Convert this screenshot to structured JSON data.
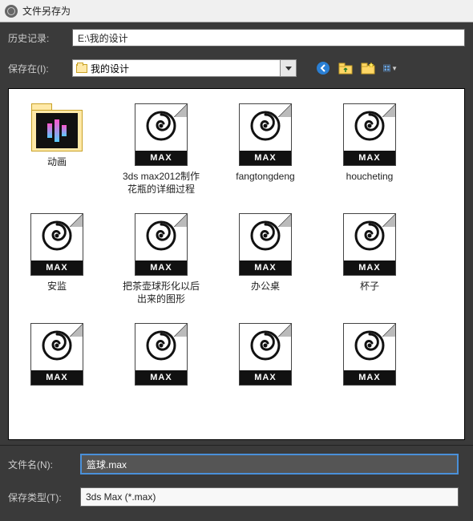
{
  "window": {
    "title": "文件另存为"
  },
  "history": {
    "label": "历史记录:",
    "value": "E:\\我的设计"
  },
  "saveIn": {
    "label": "保存在(I):",
    "value": "我的设计"
  },
  "toolbar": {
    "back": "back-icon",
    "up": "up-icon",
    "newFolder": "new-folder-icon",
    "viewMenu": "view-menu-icon"
  },
  "files": [
    {
      "type": "folder",
      "name": "动画"
    },
    {
      "type": "max",
      "name": "3ds max2012制作花瓶的详细过程"
    },
    {
      "type": "max",
      "name": "fangtongdeng"
    },
    {
      "type": "max",
      "name": "houcheting"
    },
    {
      "type": "max",
      "name": "安监"
    },
    {
      "type": "max",
      "name": "把茶壶球形化以后出来的图形"
    },
    {
      "type": "max",
      "name": "办公桌"
    },
    {
      "type": "max",
      "name": "杯子"
    },
    {
      "type": "max",
      "name": ""
    },
    {
      "type": "max",
      "name": ""
    },
    {
      "type": "max",
      "name": ""
    },
    {
      "type": "max",
      "name": ""
    }
  ],
  "maxBadge": "MAX",
  "filename": {
    "label": "文件名(N):",
    "value": "篮球.max"
  },
  "filetype": {
    "label": "保存类型(T):",
    "value": "3ds Max (*.max)"
  }
}
